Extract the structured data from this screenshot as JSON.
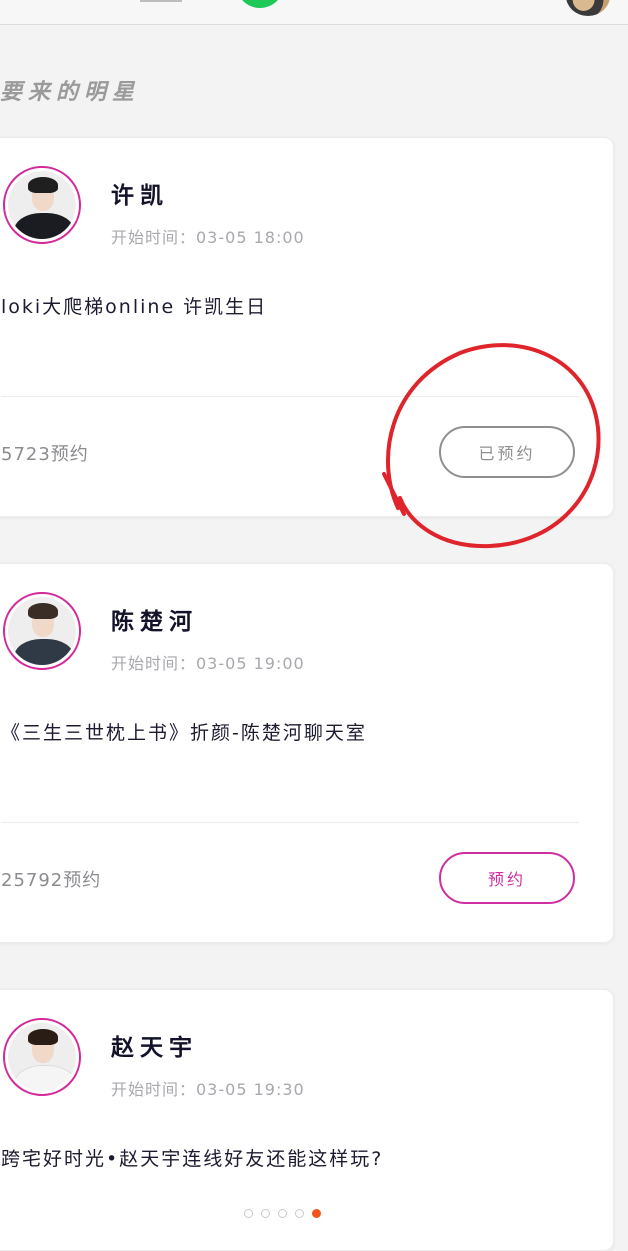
{
  "section": {
    "title": "要来的明星"
  },
  "cards": [
    {
      "name": "许凯",
      "start_time": "开始时间：03-05 18:00",
      "description": "loki大爬梯online 许凯生日",
      "reserve_count": "5723预约",
      "button_label": "已预约",
      "button_state": "reserved"
    },
    {
      "name": "陈楚河",
      "start_time": "开始时间：03-05 19:00",
      "description": "《三生三世枕上书》折颜-陈楚河聊天室",
      "reserve_count": "25792预约",
      "button_label": "预约",
      "button_state": "reserve"
    },
    {
      "name": "赵天宇",
      "start_time": "开始时间：03-05 19:30",
      "description": "跨宅好时光•赵天宇连线好友还能这样玩?"
    }
  ],
  "pager": {
    "count": 5,
    "active_index": 4
  },
  "colors": {
    "accent_pink": "#cf2ea0",
    "reserved_gray": "#8f8f8f",
    "annotation_red": "#e0242b",
    "pager_active": "#f2541b"
  },
  "icons": [
    "user-avatar-icon",
    "star-avatar-icon"
  ]
}
